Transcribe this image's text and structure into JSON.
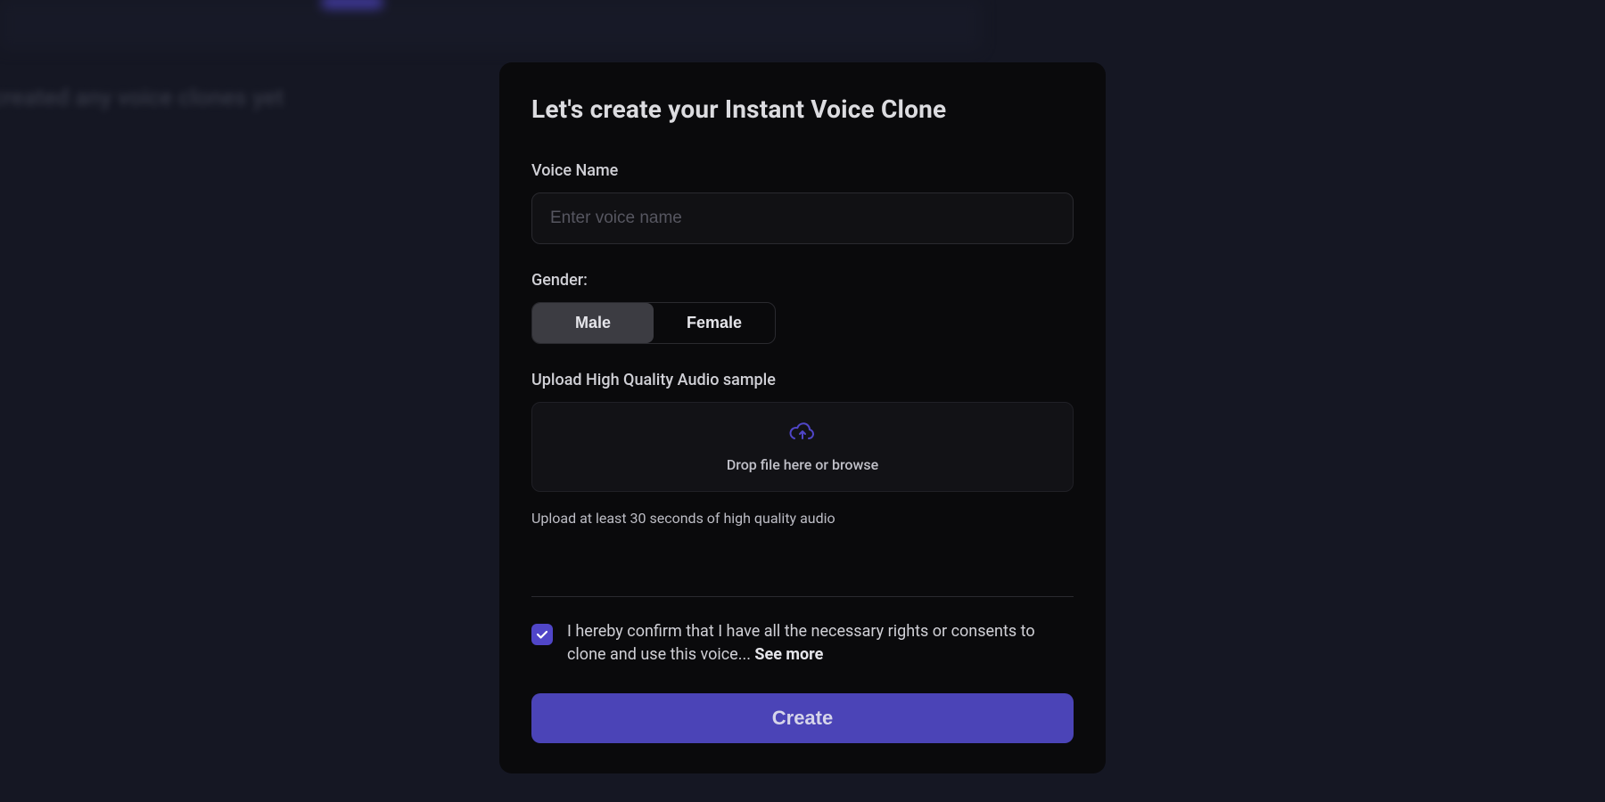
{
  "backdrop": {
    "blurred_text": "created any voice clones yet"
  },
  "modal": {
    "title": "Let's create your Instant Voice Clone",
    "voice_name": {
      "label": "Voice Name",
      "placeholder": "Enter voice name",
      "value": ""
    },
    "gender": {
      "label": "Gender:",
      "options": [
        "Male",
        "Female"
      ],
      "selected": "Male"
    },
    "upload": {
      "label": "Upload High Quality Audio sample",
      "dropzone_text": "Drop file here or browse",
      "hint": "Upload at least 30 seconds of high quality audio"
    },
    "consent": {
      "checked": true,
      "text": "I hereby confirm that I have all the necessary rights or consents to clone and use this voice... ",
      "see_more": "See more"
    },
    "create_label": "Create"
  }
}
